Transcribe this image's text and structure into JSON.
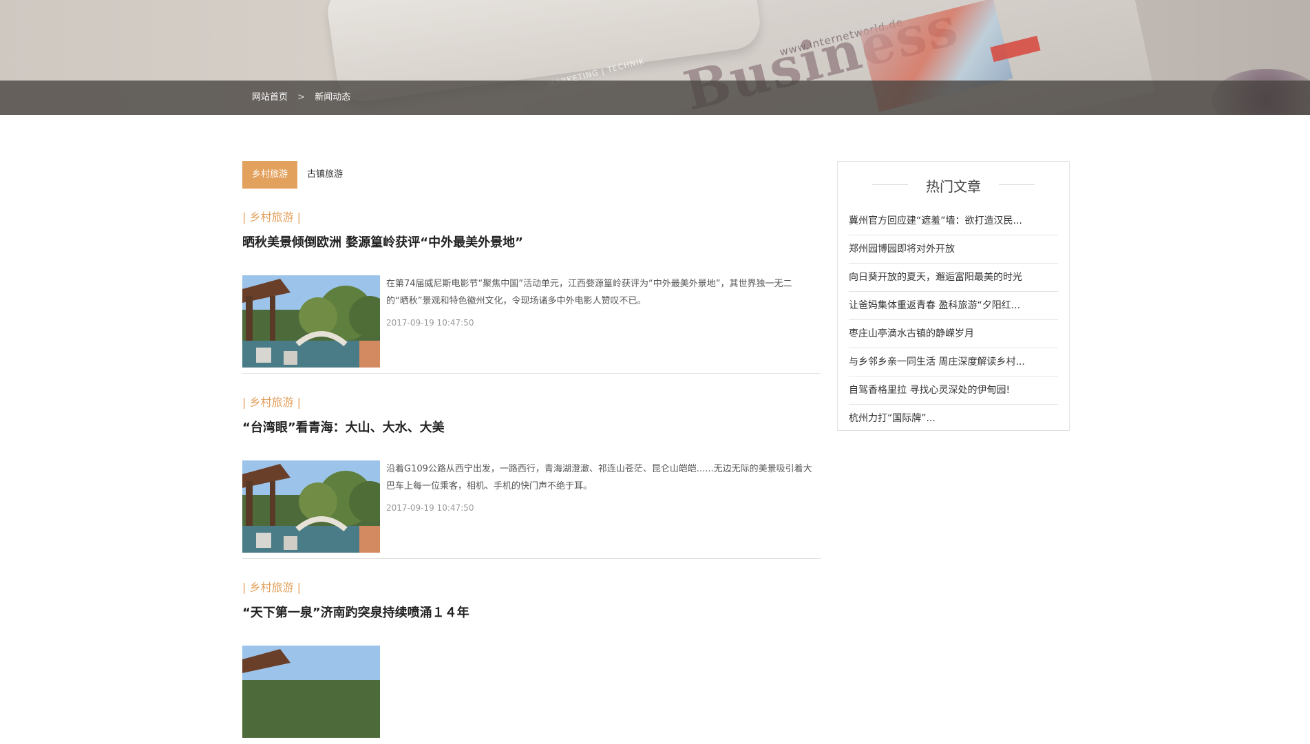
{
  "breadcrumb": {
    "home": "网站首页",
    "separator": ">",
    "current": "新闻动态"
  },
  "banner": {
    "headline_word": "Business",
    "url_text": "www.internetworld.de",
    "tagline": "-MARKETING | TECHNIK"
  },
  "tabs": [
    {
      "label": "乡村旅游",
      "active": true
    },
    {
      "label": "古镇旅游",
      "active": false
    }
  ],
  "articles": [
    {
      "category": "| 乡村旅游 |",
      "title": "晒秋美景倾倒欧洲 婺源篁岭获评“中外最美外景地”",
      "summary": "在第74届威尼斯电影节“聚焦中国”活动单元，江西婺源篁岭获评为“中外最美外景地”，其世界独一无二的“晒秋”景观和特色徽州文化，令现场诸多中外电影人赞叹不已。",
      "date": "2017-09-19 10:47:50"
    },
    {
      "category": "| 乡村旅游 |",
      "title": "“台湾眼”看青海：大山、大水、大美",
      "summary": "沿着G109公路从西宁出发，一路西行，青海湖澄澈、祁连山苍茫、昆仑山皑皑......无边无际的美景吸引着大巴车上每一位乘客，相机、手机的快门声不绝于耳。",
      "date": "2017-09-19 10:47:50"
    },
    {
      "category": "| 乡村旅游 |",
      "title": "“天下第一泉”济南趵突泉持续喷涌１４年",
      "summary": "",
      "date": ""
    }
  ],
  "sidebar": {
    "title": "热门文章",
    "items": [
      "冀州官方回应建“遮羞”墙：欲打造汉民...",
      "郑州园博园即将对外开放",
      "向日葵开放的夏天，邂逅富阳最美的时光",
      "让爸妈集体重返青春 盈科旅游“夕阳红...",
      "枣庄山亭滴水古镇的静嵘岁月",
      "与乡邻乡亲一同生活 周庄深度解读乡村...",
      "自驾香格里拉 寻找心灵深处的伊甸园!",
      "杭州力打“国际牌”..."
    ]
  },
  "colors": {
    "accent": "#e3a15e",
    "breadcrumb_bar": "#46423f",
    "divider": "#e2e2e2"
  }
}
